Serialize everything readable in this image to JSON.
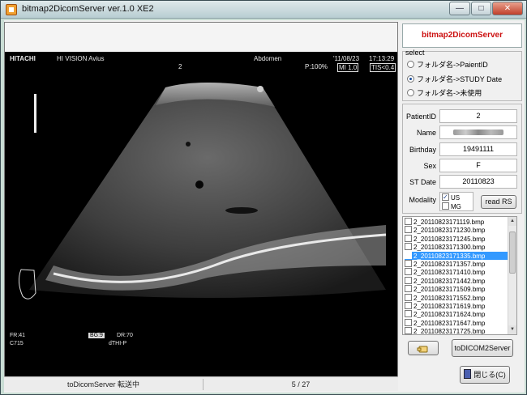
{
  "window": {
    "title": "bitmap2DicomServer ver.1.0 XE2"
  },
  "titlebar_buttons": {
    "minimize": "—",
    "maximize": "□",
    "close": "✕"
  },
  "image": {
    "brand": "HITACHI",
    "model": "HI VISION Avius",
    "exam": "Abdomen",
    "date": "'11/08/23",
    "time": "17:13:29",
    "patient_no": "2",
    "power": "P:100%",
    "mi": "MI 1.0",
    "tis": "TIS<0.4",
    "fr": "FR:41",
    "code": "C715",
    "bg": "BG:9",
    "dr": "DR:70",
    "mode": "dTHI-P"
  },
  "status": {
    "message": "toDicomServer 転送中",
    "page": "5 / 27"
  },
  "panel": {
    "title": "bitmap2DicomServer",
    "select_label": "select",
    "radios": [
      {
        "label": "フォルダ名->PaientID",
        "checked": false
      },
      {
        "label": "フォルダ名->STUDY Date",
        "checked": true
      },
      {
        "label": "フォルダ名->未使用",
        "checked": false
      }
    ],
    "fields": {
      "patient_id_label": "PatientID",
      "patient_id": "2",
      "name_label": "Name",
      "birthday_label": "Birthday",
      "birthday": "19491111",
      "sex_label": "Sex",
      "sex": "F",
      "st_date_label": "ST Date",
      "st_date": "20110823"
    },
    "modality_label": "Modality",
    "modalities": [
      {
        "label": "US",
        "checked": true
      },
      {
        "label": "MG",
        "checked": false
      }
    ],
    "read_button": "read RS",
    "files": [
      "2_20110823171119.bmp",
      "2_20110823171230.bmp",
      "2_20110823171245.bmp",
      "2_20110823171300.bmp",
      "2_20110823171335.bmp",
      "2_20110823171357.bmp",
      "2_20110823171410.bmp",
      "2_20110823171442.bmp",
      "2_20110823171509.bmp",
      "2_20110823171552.bmp",
      "2_20110823171619.bmp",
      "2_20110823171624.bmp",
      "2_20110823171647.bmp",
      "2_20110823171725.bmp"
    ],
    "selected_file": "2_20110823171335.bmp",
    "to_dicom_button": "toDICOM2Server",
    "close_button": "閉じる(C)"
  }
}
